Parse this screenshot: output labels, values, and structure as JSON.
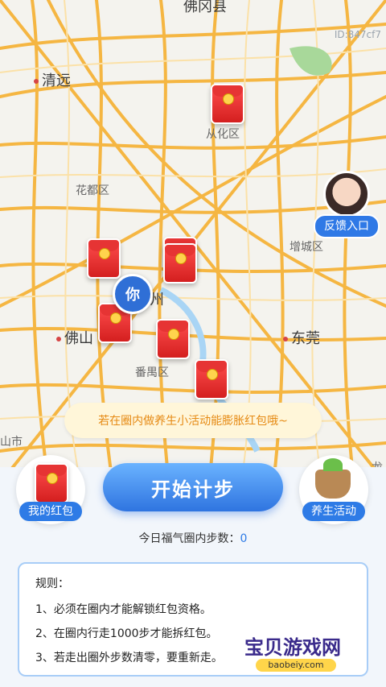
{
  "map": {
    "top_label": "佛冈县",
    "id_text": "ID:847cf7",
    "places": [
      "清远",
      "从化区",
      "花都区",
      "增城区",
      "你",
      "州",
      "佛山",
      "东莞",
      "番禺区",
      "山市",
      "龙"
    ]
  },
  "feedback": {
    "label": "反馈入口"
  },
  "tip": {
    "text": "若在圈内做养生小活动能膨胀红包哦~"
  },
  "buttons": {
    "my_packet": "我的红包",
    "start": "开始计步",
    "health": "养生活动"
  },
  "steps": {
    "label": "今日福气圈内步数：",
    "value": "0"
  },
  "rules": {
    "title": "规则：",
    "items": [
      "1、必须在圈内才能解锁红包资格。",
      "2、在圈内行走1000步才能拆红包。",
      "3、若走出圈外步数清零，要重新走。"
    ]
  },
  "watermark": {
    "big": "宝贝游戏网",
    "small": "baobeiy.com"
  }
}
